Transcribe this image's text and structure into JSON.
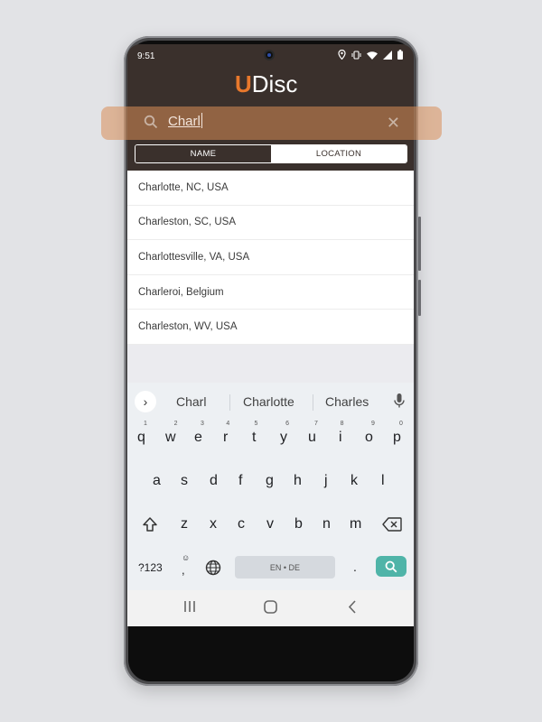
{
  "status_bar": {
    "time": "9:51"
  },
  "app": {
    "logo_u": "U",
    "logo_rest": "Disc"
  },
  "search": {
    "query": "Charl",
    "clear_icon": "close-icon",
    "search_icon": "search-icon"
  },
  "segment": {
    "tabs": [
      "NAME",
      "LOCATION"
    ],
    "selected": "LOCATION"
  },
  "results": [
    "Charlotte, NC, USA",
    "Charleston, SC, USA",
    "Charlottesville, VA, USA",
    "Charleroi, Belgium",
    "Charleston, WV, USA"
  ],
  "keyboard": {
    "suggestions": [
      "Charl",
      "Charlotte",
      "Charles"
    ],
    "row1": [
      "q",
      "w",
      "e",
      "r",
      "t",
      "y",
      "u",
      "i",
      "o",
      "p"
    ],
    "row1_hints": [
      "1",
      "2",
      "3",
      "4",
      "5",
      "6",
      "7",
      "8",
      "9",
      "0"
    ],
    "row2": [
      "a",
      "s",
      "d",
      "f",
      "g",
      "h",
      "j",
      "k",
      "l"
    ],
    "row3": [
      "z",
      "x",
      "c",
      "v",
      "b",
      "n",
      "m"
    ],
    "symbols_label": "?123",
    "comma_label": ",",
    "period_label": ".",
    "space_label": "EN • DE"
  },
  "colors": {
    "header": "#3a302c",
    "accent": "#e8782c",
    "search_highlight": "#d98e57",
    "keyboard_action": "#4fb4a8"
  }
}
